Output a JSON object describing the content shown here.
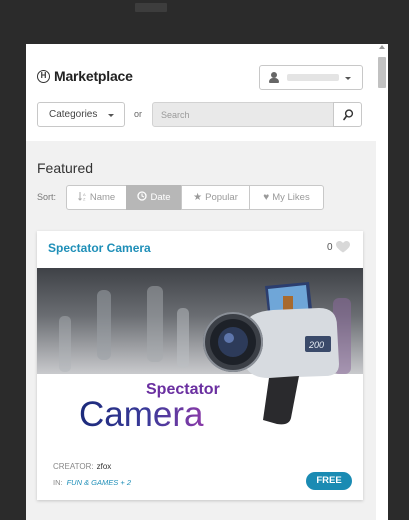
{
  "colors": {
    "accent": "#1a8bb3",
    "link": "#1f8fb8",
    "page_bg": "#2b2b2b",
    "panel_bg": "#f1f1f1"
  },
  "header": {
    "logo_glyph": "H",
    "title": "Marketplace",
    "user_menu": {
      "icon": "user-icon"
    },
    "categories_label": "Categories",
    "or_label": "or",
    "search_placeholder": "Search",
    "search_icon": "search-icon"
  },
  "featured_heading": "Featured",
  "sort": {
    "label": "Sort:",
    "options": [
      {
        "label": "Name",
        "icon": "sort-alpha-icon",
        "active": false
      },
      {
        "label": "Date",
        "icon": "clock-icon",
        "active": true
      },
      {
        "label": "Popular",
        "icon": "star-icon",
        "active": false
      },
      {
        "label": "My Likes",
        "icon": "heart-icon",
        "active": false
      }
    ]
  },
  "items": [
    {
      "title": "Spectator Camera",
      "likes": "0",
      "image": {
        "caption_top": "Spectator",
        "caption_bottom": "Camera",
        "camera_label": "200"
      },
      "creator_label": "CREATOR:",
      "creator": "zfox",
      "category_label": "IN:",
      "category": "FUN & GAMES + 2",
      "price": "FREE"
    }
  ]
}
